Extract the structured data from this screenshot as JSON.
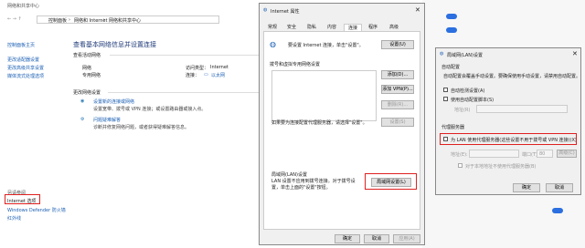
{
  "colors": {
    "accent": "#1a5fb4",
    "red": "#e02020",
    "toggle": "#2b6fe0"
  },
  "network_center": {
    "title": "网络和共享中心",
    "breadcrumb": [
      "控制面板",
      "网络和 Internet",
      "网络和共享中心"
    ],
    "left_nav": [
      "控制面板主页",
      "更改适配器设置",
      "更改高级共享设置",
      "媒体流式处理选项"
    ],
    "heading": "查看基本网络信息并设置连接",
    "active_networks_label": "查看活动网络",
    "network_name": "网络",
    "network_type": "专用网络",
    "access_type_label": "访问类型：",
    "access_type_value": "Internet",
    "connection_label": "连接：",
    "connection_value": "以太网",
    "change_settings_label": "更改网络设置",
    "setup_new": {
      "title": "设置新的连接或网络",
      "desc": "设置宽带、拨号或 VPN 连接；或设置路由器或接入点。"
    },
    "troubleshoot": {
      "title": "问题疑难解答",
      "desc": "诊断并修复网络问题，或者获得疑难解答信息。"
    },
    "see_also_label": "另请参阅",
    "see_also": [
      "Internet 选项",
      "Windows Defender 防火墙",
      "红外线"
    ]
  },
  "internet_props": {
    "title": "Internet 属性",
    "tabs": [
      "常规",
      "安全",
      "隐私",
      "内容",
      "连接",
      "程序",
      "高级"
    ],
    "setup_text": "要设置 Internet 连接，单击\"设置\"。",
    "setup_button": "设置(U)",
    "dialup_label": "拨号和虚拟专用网络设置",
    "add_button": "添加(D)...",
    "add_vpn_button": "添加 VPN(P)...",
    "remove_button": "删除(R)...",
    "settings_button": "设置(S)",
    "proxy_hint": "如果要为连接配置代理服务器，请选择\"设置\"。",
    "lan_label": "局域网(LAN)设置",
    "lan_desc": "LAN 设置不应用到拨号连接。对于拨号设置，单击上面的\"设置\"按钮。",
    "lan_button": "局域网设置(L)",
    "ok": "确定",
    "cancel": "取消",
    "apply": "应用(A)"
  },
  "lan_dialog": {
    "title": "局域网(LAN)设置",
    "auto_config_label": "自动配置",
    "auto_config_desc": "自动配置会覆盖手动设置。要确保使用手动设置，请禁用自动配置。",
    "auto_detect": "自动检测设置(A)",
    "use_script": "使用自动配置脚本(S)",
    "address_label": "地址(R)",
    "proxy_label": "代理服务器",
    "use_proxy": "为 LAN 使用代理服务器(这些设置不用于拨号或 VPN 连接)(X)",
    "addr_field_label": "地址(E):",
    "port_label": "端口(T):",
    "port_value": "80",
    "advanced_button": "高级(C)",
    "bypass_local": "对于本地地址不使用代理服务器(B)",
    "ok": "确定",
    "cancel": "取消"
  }
}
